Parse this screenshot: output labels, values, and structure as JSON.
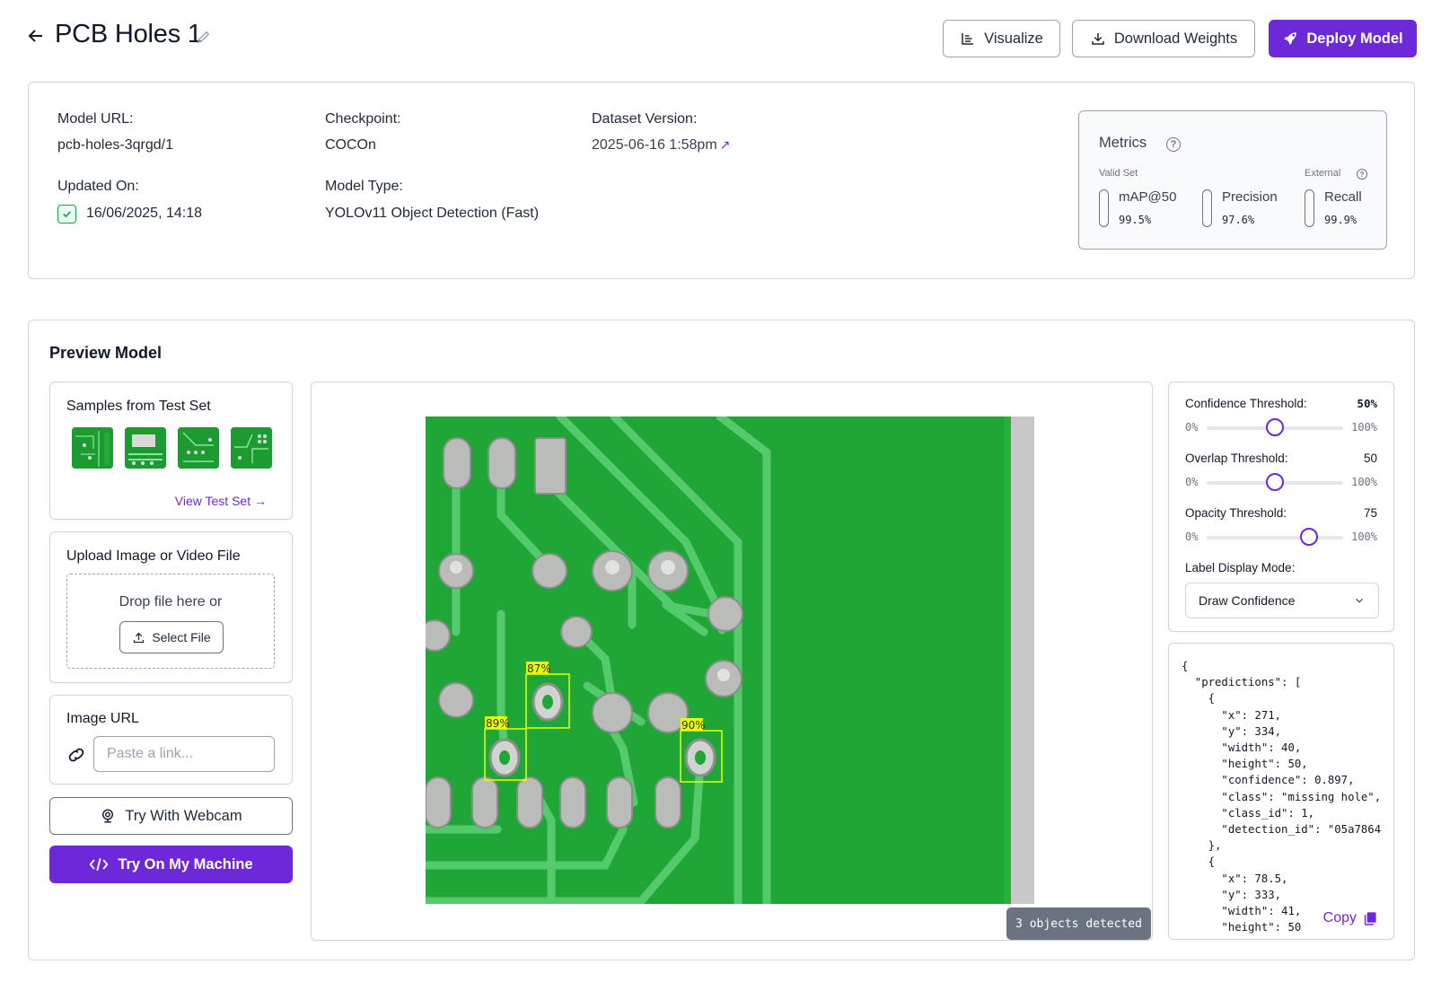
{
  "header": {
    "title": "PCB Holes 1",
    "buttons": {
      "visualize": "Visualize",
      "download": "Download Weights",
      "deploy": "Deploy Model"
    }
  },
  "info": {
    "model_url_label": "Model URL:",
    "model_url": "pcb-holes-3qrgd/1",
    "checkpoint_label": "Checkpoint:",
    "checkpoint": "COCOn",
    "dataset_label": "Dataset Version:",
    "dataset": "2025-06-16 1:58pm",
    "updated_label": "Updated On:",
    "updated": "16/06/2025, 14:18",
    "type_label": "Model Type:",
    "type": "YOLOv11 Object Detection (Fast)"
  },
  "metrics": {
    "title": "Metrics",
    "valid_set": "Valid Set",
    "external": "External",
    "items": [
      {
        "name": "mAP@50",
        "value": "99.5%"
      },
      {
        "name": "Precision",
        "value": "97.6%"
      },
      {
        "name": "Recall",
        "value": "99.9%"
      }
    ]
  },
  "preview": {
    "title": "Preview Model",
    "samples_title": "Samples from Test Set",
    "view_test": "View Test Set",
    "upload_title": "Upload Image or Video File",
    "drop_text": "Drop file here or",
    "select_file": "Select File",
    "url_title": "Image URL",
    "url_placeholder": "Paste a link...",
    "webcam": "Try With Webcam",
    "machine": "Try On My Machine",
    "objects_detected": "3 objects detected"
  },
  "detections": [
    {
      "label": "87%"
    },
    {
      "label": "89%"
    },
    {
      "label": "90%"
    }
  ],
  "controls": {
    "confidence_label": "Confidence Threshold:",
    "confidence_value": "50%",
    "confidence_level": 50,
    "overlap_label": "Overlap Threshold:",
    "overlap_value": "50",
    "overlap_level": 50,
    "opacity_label": "Opacity Threshold:",
    "opacity_value": "75",
    "opacity_level": 75,
    "min": "0%",
    "max": "100%",
    "label_mode_label": "Label Display Mode:",
    "label_mode": "Draw Confidence"
  },
  "json_output": "{\n  \"predictions\": [\n    {\n      \"x\": 271,\n      \"y\": 334,\n      \"width\": 40,\n      \"height\": 50,\n      \"confidence\": 0.897,\n      \"class\": \"missing hole\",\n      \"class_id\": 1,\n      \"detection_id\": \"05a7864\n    },\n    {\n      \"x\": 78.5,\n      \"y\": 333,\n      \"width\": 41,\n      \"height\": 50",
  "copy_label": "Copy",
  "colors": {
    "accent": "#6d28d9",
    "pcb_green": "#1fa637",
    "box": "#e6ff00"
  }
}
